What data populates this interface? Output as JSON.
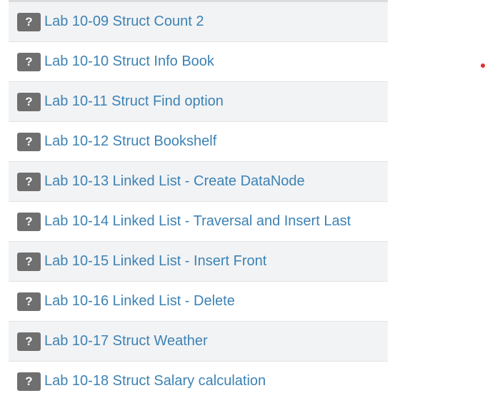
{
  "labs": [
    {
      "icon": "question-mark-icon",
      "glyph": "?",
      "label": "Lab 10-09 Struct Count 2"
    },
    {
      "icon": "question-mark-icon",
      "glyph": "?",
      "label": "Lab 10-10 Struct Info Book"
    },
    {
      "icon": "question-mark-icon",
      "glyph": "?",
      "label": "Lab 10-11 Struct Find option"
    },
    {
      "icon": "question-mark-icon",
      "glyph": "?",
      "label": "Lab 10-12 Struct Bookshelf"
    },
    {
      "icon": "question-mark-icon",
      "glyph": "?",
      "label": "Lab 10-13 Linked List - Create DataNode"
    },
    {
      "icon": "question-mark-icon",
      "glyph": "?",
      "label": "Lab 10-14 Linked List - Traversal and Insert Last"
    },
    {
      "icon": "question-mark-icon",
      "glyph": "?",
      "label": "Lab 10-15 Linked List - Insert Front"
    },
    {
      "icon": "question-mark-icon",
      "glyph": "?",
      "label": "Lab 10-16 Linked List - Delete"
    },
    {
      "icon": "question-mark-icon",
      "glyph": "?",
      "label": "Lab 10-17 Struct Weather"
    },
    {
      "icon": "question-mark-icon",
      "glyph": "?",
      "label": "Lab 10-18 Struct Salary calculation"
    }
  ],
  "colors": {
    "link": "#3c82b4",
    "icon_bg": "#6f6f6f",
    "row_alt_bg": "#f2f3f5",
    "marker": "#e0322f"
  }
}
